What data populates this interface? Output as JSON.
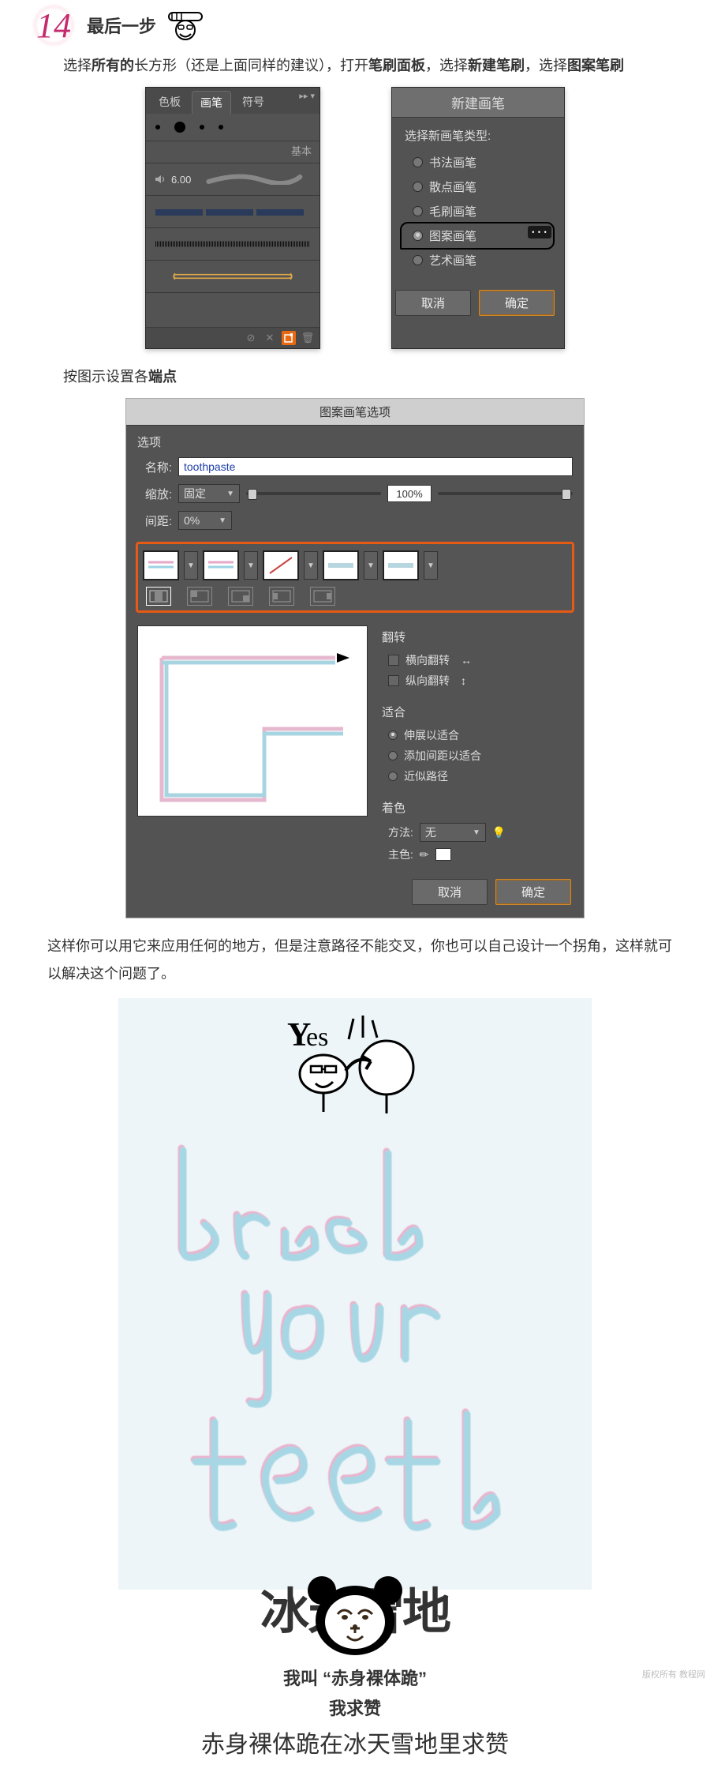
{
  "step": {
    "number": "14",
    "label": "最后一步"
  },
  "intro": {
    "pre": "选择",
    "b1": "所有的",
    "mid": "长方形（还是上面同样的建议），打开",
    "b2": "笔刷面板",
    "mid2": "，选择",
    "b3": "新建笔刷",
    "mid3": "，选择",
    "b4": "图案笔刷"
  },
  "brush_panel": {
    "tabs": [
      "色板",
      "画笔",
      "符号"
    ],
    "basic_label": "基本",
    "size_value": "6.00"
  },
  "new_brush": {
    "title": "新建画笔",
    "label": "选择新画笔类型:",
    "options": [
      "书法画笔",
      "散点画笔",
      "毛刷画笔",
      "图案画笔",
      "艺术画笔"
    ],
    "selected_index": 3,
    "cancel": "取消",
    "ok": "确定"
  },
  "endpoint_note": "按图示设置各",
  "endpoint_bold": "端点",
  "options_dialog": {
    "title": "图案画笔选项",
    "section": "选项",
    "name_label": "名称:",
    "name_value": "toothpaste",
    "scale_label": "缩放:",
    "scale_mode": "固定",
    "scale_pct": "100%",
    "spacing_label": "间距:",
    "spacing_value": "0%",
    "flip_header": "翻转",
    "flip_h": "横向翻转",
    "flip_v": "纵向翻转",
    "fit_header": "适合",
    "fit_opts": [
      "伸展以适合",
      "添加间距以适合",
      "近似路径"
    ],
    "fit_selected": 0,
    "color_header": "着色",
    "method_label": "方法:",
    "method_value": "无",
    "keycolor_label": "主色:",
    "cancel": "取消",
    "ok": "确定"
  },
  "outro": "这样你可以用它来应用任何的地方，但是注意路径不能交叉，你也可以自己设计一个拐角，这样就可以解决这个问题了。",
  "result": {
    "yes": "Yes",
    "word1": "brush",
    "word2": "your",
    "word3": "teeth"
  },
  "meme": {
    "big": "冰天雪地",
    "line1": "我叫 “赤身裸体跪”",
    "line2": "我求赞",
    "kai": "赤身裸体跪在冰天雪地里求赞"
  },
  "watermark": "版权所有 教程网"
}
